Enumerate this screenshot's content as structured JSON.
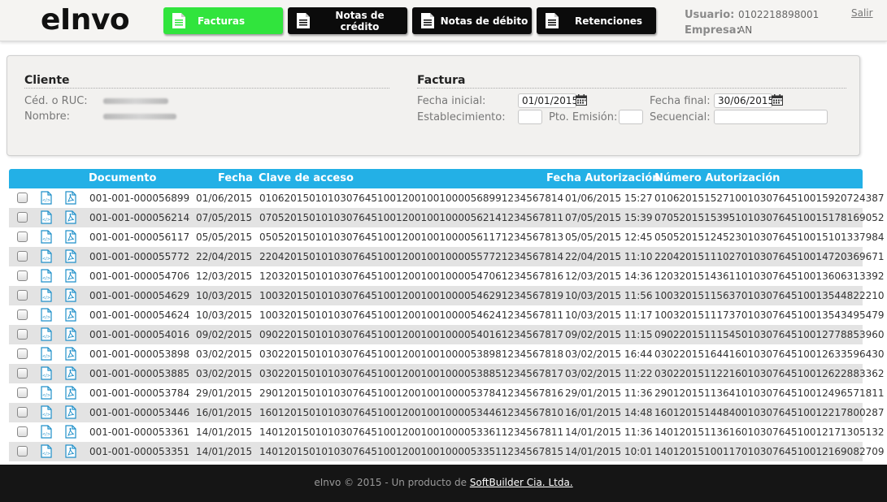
{
  "app": {
    "logo": "eInvo"
  },
  "nav": [
    {
      "label": "Facturas",
      "active": true
    },
    {
      "label": "Notas de crédito",
      "active": false
    },
    {
      "label": "Notas de débito",
      "active": false
    },
    {
      "label": "Retenciones",
      "active": false
    }
  ],
  "user": {
    "usuario_label": "Usuario:",
    "usuario_value": "0102218898001",
    "empresa_label": "Empresa:",
    "empresa_value": "AN",
    "logout_label": "Salir"
  },
  "filters": {
    "cliente_title": "Cliente",
    "ruc_label": "Céd. o RUC:",
    "nombre_label": "Nombre:",
    "factura_title": "Factura",
    "fecha_inicial_label": "Fecha inicial:",
    "fecha_inicial_value": "01/01/2015",
    "fecha_final_label": "Fecha final:",
    "fecha_final_value": "30/06/2015",
    "establecimiento_label": "Establecimiento:",
    "establecimiento_value": "",
    "pto_emision_label": "Pto. Emisión:",
    "pto_emision_value": "",
    "secuencial_label": "Secuencial:",
    "secuencial_value": ""
  },
  "table": {
    "headers": {
      "documento": "Documento",
      "fecha": "Fecha",
      "clave": "Clave de acceso",
      "fecha_aut": "Fecha Autorización",
      "num_aut": "Número Autorización"
    },
    "rows": [
      {
        "documento": "001-001-000056899",
        "fecha": "01/06/2015",
        "clave": "0106201501010307645100120010010000568991234567814",
        "fecha_aut": "01/06/2015 15:27",
        "num_aut": "0106201515271001030764510015920724387"
      },
      {
        "documento": "001-001-000056214",
        "fecha": "07/05/2015",
        "clave": "0705201501010307645100120010010000562141234567811",
        "fecha_aut": "07/05/2015 15:39",
        "num_aut": "0705201515395101030764510015178169052"
      },
      {
        "documento": "001-001-000056117",
        "fecha": "05/05/2015",
        "clave": "0505201501010307645100120010010000561171234567813",
        "fecha_aut": "05/05/2015 12:45",
        "num_aut": "0505201512452301030764510015101337984"
      },
      {
        "documento": "001-001-000055772",
        "fecha": "22/04/2015",
        "clave": "2204201501010307645100120010010000557721234567814",
        "fecha_aut": "22/04/2015 11:10",
        "num_aut": "2204201511102701030764510014720369671"
      },
      {
        "documento": "001-001-000054706",
        "fecha": "12/03/2015",
        "clave": "1203201501010307645100120010010000547061234567816",
        "fecha_aut": "12/03/2015 14:36",
        "num_aut": "1203201514361101030764510013606313392"
      },
      {
        "documento": "001-001-000054629",
        "fecha": "10/03/2015",
        "clave": "1003201501010307645100120010010000546291234567819",
        "fecha_aut": "10/03/2015 11:56",
        "num_aut": "1003201511563701030764510013544822210"
      },
      {
        "documento": "001-001-000054624",
        "fecha": "10/03/2015",
        "clave": "1003201501010307645100120010010000546241234567811",
        "fecha_aut": "10/03/2015 11:17",
        "num_aut": "1003201511173701030764510013543495479"
      },
      {
        "documento": "001-001-000054016",
        "fecha": "09/02/2015",
        "clave": "0902201501010307645100120010010000540161234567817",
        "fecha_aut": "09/02/2015 11:15",
        "num_aut": "0902201511154501030764510012778853960"
      },
      {
        "documento": "001-001-000053898",
        "fecha": "03/02/2015",
        "clave": "0302201501010307645100120010010000538981234567818",
        "fecha_aut": "03/02/2015 16:44",
        "num_aut": "0302201516441601030764510012633596430"
      },
      {
        "documento": "001-001-000053885",
        "fecha": "03/02/2015",
        "clave": "0302201501010307645100120010010000538851234567817",
        "fecha_aut": "03/02/2015 11:22",
        "num_aut": "0302201511221601030764510012622883362"
      },
      {
        "documento": "001-001-000053784",
        "fecha": "29/01/2015",
        "clave": "2901201501010307645100120010010000537841234567816",
        "fecha_aut": "29/01/2015 11:36",
        "num_aut": "2901201511364101030764510012496571811"
      },
      {
        "documento": "001-001-000053446",
        "fecha": "16/01/2015",
        "clave": "1601201501010307645100120010010000534461234567810",
        "fecha_aut": "16/01/2015 14:48",
        "num_aut": "1601201514484001030764510012217800287"
      },
      {
        "documento": "001-001-000053361",
        "fecha": "14/01/2015",
        "clave": "1401201501010307645100120010010000533611234567811",
        "fecha_aut": "14/01/2015 11:36",
        "num_aut": "1401201511361601030764510012171305132"
      },
      {
        "documento": "001-001-000053351",
        "fecha": "14/01/2015",
        "clave": "1401201501010307645100120010010000533511234567815",
        "fecha_aut": "14/01/2015 10:01",
        "num_aut": "1401201510011701030764510012169082709"
      }
    ]
  },
  "footer": {
    "text": "eInvo © 2015 - Un producto de ",
    "link": "SoftBuilder Cia. Ltda."
  },
  "colors": {
    "accent_green": "#31e43d",
    "header_blue": "#23b0e6",
    "nav_black": "#0b0b0b"
  },
  "icons": [
    "document-icon",
    "calendar-icon",
    "xml-file-icon",
    "pdf-file-icon",
    "checkbox"
  ]
}
